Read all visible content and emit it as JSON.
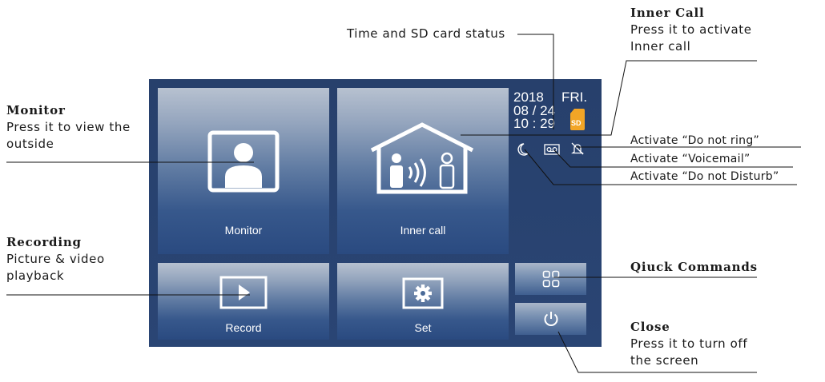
{
  "screen": {
    "tiles": {
      "monitor": "Monitor",
      "inner_call": "Inner call",
      "record": "Record",
      "set": "Set"
    },
    "status": {
      "year": "2018",
      "weekday": "FRI.",
      "date": "08 / 24",
      "time": "10 : 29",
      "sd_label": "SD"
    },
    "colors": {
      "screen_bg": "#2a4574",
      "tile_top": "#b7c1d0",
      "tile_bottom": "#2a4a80",
      "sd_badge": "#f2a526"
    }
  },
  "annotations": {
    "time_sd": "Time and SD card status",
    "inner_call": {
      "title": "Inner Call",
      "line1": "Press it to activate",
      "line2": "Inner call"
    },
    "monitor": {
      "title": "Monitor",
      "line1": "Press it to view the",
      "line2": "outside"
    },
    "recording": {
      "title": "Recording",
      "line1": "Picture & video",
      "line2": "playback"
    },
    "do_not_ring": "Activate “Do not ring”",
    "voicemail": "Activate “Voicemail”",
    "do_not_disturb": "Activate “Do not Disturb”",
    "quick_commands": "Qiuck Commands",
    "close": {
      "title": "Close",
      "line1": "Press it to turn off",
      "line2": "the screen"
    }
  },
  "icons": {
    "monitor": "person-in-frame-icon",
    "inner_call": "house-with-people-icon",
    "record": "play-icon",
    "set": "gear-icon",
    "quick": "grid-icon",
    "power": "power-icon",
    "moon": "moon-icon",
    "voicemail": "voicemail-icon",
    "bell_off": "bell-off-icon",
    "sd": "sd-card-icon"
  }
}
